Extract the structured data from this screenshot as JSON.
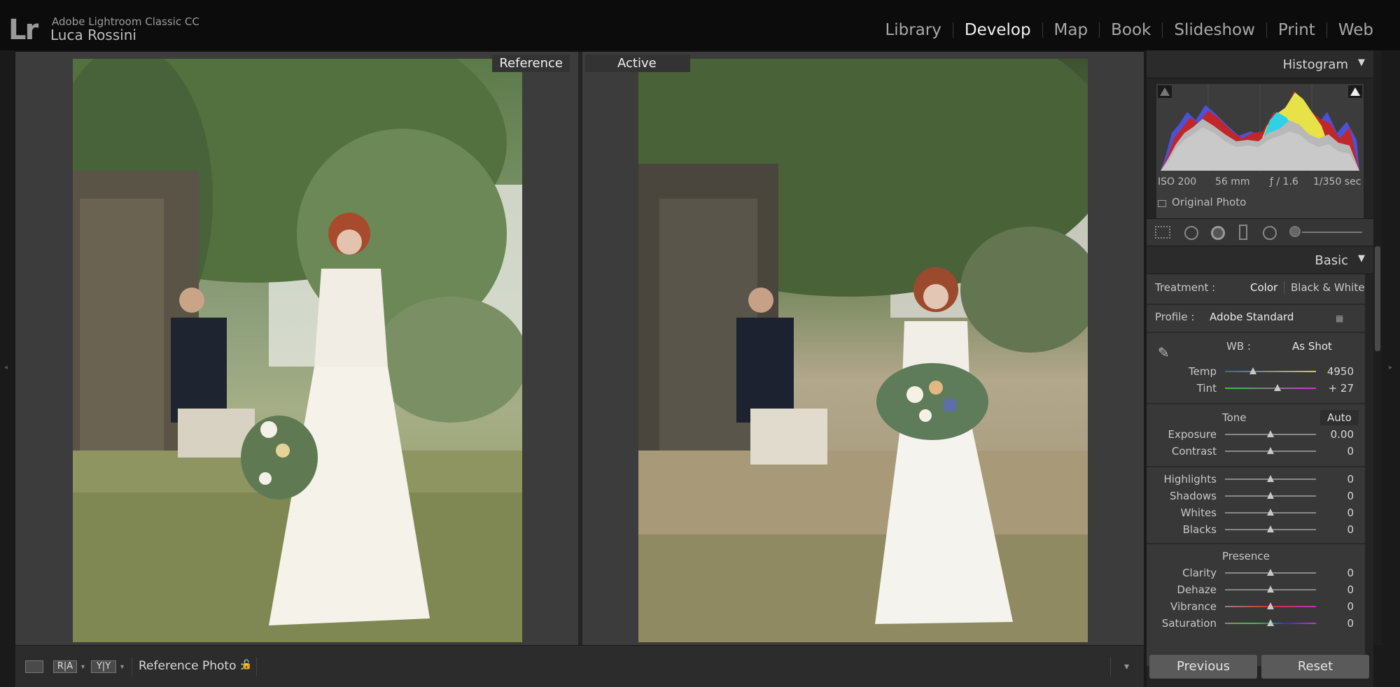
{
  "app": {
    "logo": "Lr",
    "name": "Adobe Lightroom Classic CC",
    "user": "Luca Rossini"
  },
  "modules": [
    "Library",
    "Develop",
    "Map",
    "Book",
    "Slideshow",
    "Print",
    "Web"
  ],
  "active_module": "Develop",
  "compare": {
    "reference_label": "Reference",
    "active_label": "Active"
  },
  "toolbar": {
    "ref_view": "R|A",
    "yy_view": "Y|Y",
    "reference_photo_label": "Reference Photo :"
  },
  "histogram": {
    "title": "Histogram",
    "iso": "ISO 200",
    "focal": "56 mm",
    "aperture": "ƒ / 1.6",
    "shutter": "1/350 sec",
    "original_photo": "Original Photo"
  },
  "basic": {
    "title": "Basic",
    "treatment_label": "Treatment :",
    "treatment_color": "Color",
    "treatment_bw": "Black & White",
    "profile_label": "Profile :",
    "profile_value": "Adobe Standard",
    "wb_label": "WB :",
    "wb_value": "As Shot",
    "temp_label": "Temp",
    "temp_value": "4950",
    "tint_label": "Tint",
    "tint_value": "+ 27",
    "tone_label": "Tone",
    "auto_label": "Auto",
    "exposure_label": "Exposure",
    "exposure_value": "0.00",
    "contrast_label": "Contrast",
    "contrast_value": "0",
    "highlights_label": "Highlights",
    "highlights_value": "0",
    "shadows_label": "Shadows",
    "shadows_value": "0",
    "whites_label": "Whites",
    "whites_value": "0",
    "blacks_label": "Blacks",
    "blacks_value": "0",
    "presence_label": "Presence",
    "clarity_label": "Clarity",
    "clarity_value": "0",
    "dehaze_label": "Dehaze",
    "dehaze_value": "0",
    "vibrance_label": "Vibrance",
    "vibrance_value": "0",
    "saturation_label": "Saturation",
    "saturation_value": "0"
  },
  "buttons": {
    "previous": "Previous",
    "reset": "Reset"
  }
}
